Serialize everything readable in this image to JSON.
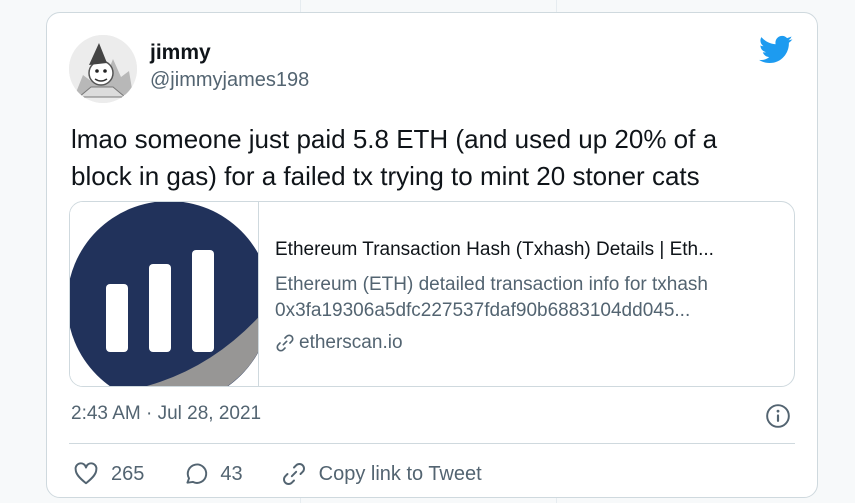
{
  "tweet": {
    "author_name": "jimmy",
    "author_handle": "@jimmyjames198",
    "text": "lmao someone just paid 5.8 ETH (and used up 20% of a block in gas) for a failed tx trying to mint 20 stoner cats",
    "timestamp": "2:43 AM · Jul 28, 2021"
  },
  "link_card": {
    "title": "Ethereum Transaction Hash (Txhash) Details | Eth...",
    "description_line1": "Ethereum (ETH) detailed transaction info for txhash",
    "description_line2": "0x3fa19306a5dfc227537fdaf90b6883104dd045...",
    "domain": "etherscan.io"
  },
  "actions": {
    "likes": "265",
    "replies": "43",
    "copy_link_label": "Copy link to Tweet"
  },
  "colors": {
    "twitter_blue": "#1d9bf0",
    "etherscan_navy": "#21325b",
    "etherscan_gray": "#979695",
    "secondary_text": "#536471"
  },
  "icons": [
    "twitter-logo-icon",
    "link-icon",
    "info-icon",
    "heart-icon",
    "reply-icon",
    "copy-link-icon"
  ]
}
